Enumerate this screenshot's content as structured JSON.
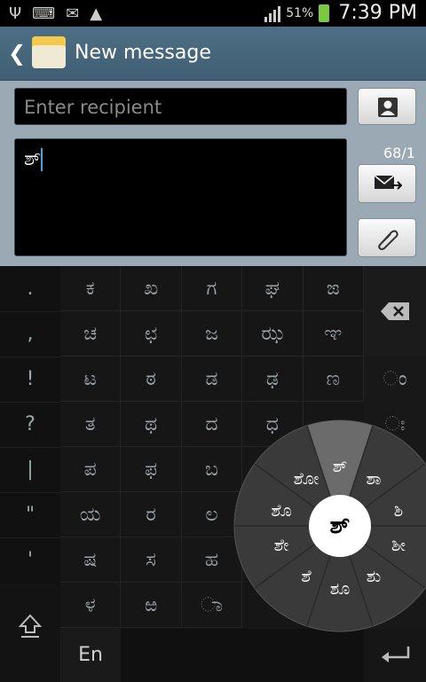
{
  "status_bar": {
    "battery_percent": "51%",
    "time": "7:39 PM"
  },
  "header": {
    "title": "New message"
  },
  "compose": {
    "recipient_placeholder": "Enter recipient",
    "message_text": "ಶ್",
    "char_counter": "68/1"
  },
  "keyboard": {
    "punctuation": [
      ".",
      ",",
      "!",
      "?",
      "|",
      "\"",
      "'"
    ],
    "letter_rows": [
      [
        "ಕ",
        "ಖ",
        "ಗ",
        "ಘ",
        "ಙ"
      ],
      [
        "ಚ",
        "ಛ",
        "ಜ",
        "ಝ",
        "ಞ"
      ],
      [
        "ಟ",
        "ಠ",
        "ಡ",
        "ಢ",
        "ಣ"
      ],
      [
        "ತ",
        "ಥ",
        "ದ",
        "ಧ",
        ""
      ],
      [
        "ಪ",
        "ಫ",
        "ಬ",
        "",
        ""
      ],
      [
        "ಯ",
        "ರ",
        "ಲ",
        "",
        ""
      ],
      [
        "ಷ",
        "ಸ",
        "ಹ",
        "",
        ""
      ],
      [
        "ಳ",
        "ಱ",
        "ಾ",
        "",
        ""
      ]
    ],
    "signs": [
      "ಂ",
      "ಃ"
    ],
    "language_label": "En"
  },
  "wheel": {
    "center": "ಶ್",
    "options": [
      "ಶ್",
      "ಶಾ",
      "ಶಿ",
      "ಶೀ",
      "ಶು",
      "ಶೂ",
      "ಶೆ",
      "ಶೇ",
      "ಶೊ",
      "ಶೋ"
    ]
  }
}
